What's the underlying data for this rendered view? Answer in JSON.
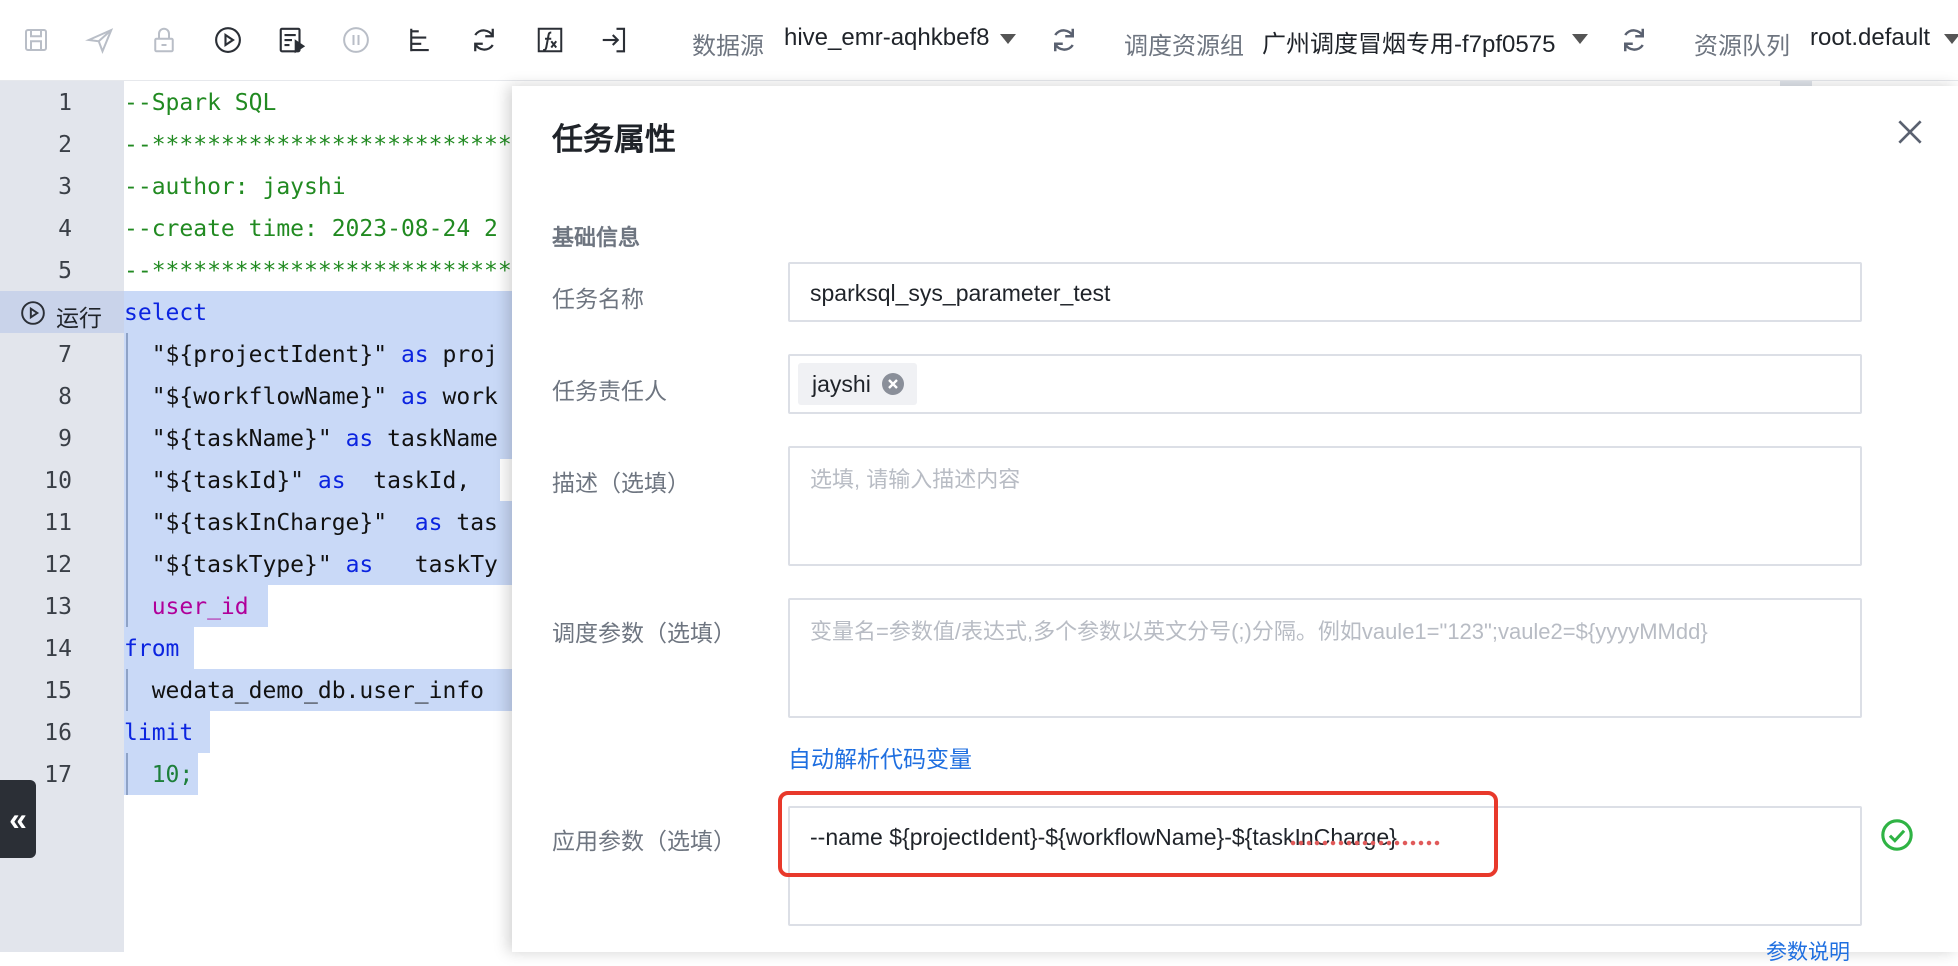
{
  "toolbar": {
    "icons": [
      "save-icon",
      "publish-icon",
      "lock-icon",
      "run-icon",
      "run-selected-icon",
      "stop-icon",
      "format-icon",
      "refresh-icon",
      "formula-icon",
      "exit-icon"
    ],
    "datasource_label": "数据源",
    "datasource_value": "hive_emr-aqhkbef8",
    "resource_group_label": "调度资源组",
    "resource_group_value": "广州调度冒烟专用-f7pf0575",
    "queue_label": "资源队列",
    "queue_value": "root.default"
  },
  "editor": {
    "run_label": "运行",
    "lines": [
      {
        "n": "1",
        "t": "--Spark SQL"
      },
      {
        "n": "2",
        "t": "--*******************************"
      },
      {
        "n": "3",
        "t": "--author: jayshi"
      },
      {
        "n": "4",
        "t": "--create time: 2023-08-24 2"
      },
      {
        "n": "5",
        "t": "--*******************************"
      },
      {
        "n": "6",
        "t": "select"
      },
      {
        "n": "7",
        "a": "  \"${projectIdent}\"",
        "b": " as ",
        "c": "proj"
      },
      {
        "n": "8",
        "a": "  \"${workflowName}\"",
        "b": " as ",
        "c": "work"
      },
      {
        "n": "9",
        "a": "  \"${taskName}\"",
        "b": " as ",
        "c": "taskName"
      },
      {
        "n": "10",
        "a": "  \"${taskId}\"",
        "b": " as ",
        "c": " taskId,"
      },
      {
        "n": "11",
        "a": "  \"${taskInCharge}\"",
        "b": "  as ",
        "c": "tas"
      },
      {
        "n": "12",
        "a": "  \"${taskType}\"",
        "b": " as ",
        "c": "  taskTy"
      },
      {
        "n": "13",
        "t": "  user_id"
      },
      {
        "n": "14",
        "t": "from"
      },
      {
        "n": "15",
        "t": "  wedata_demo_db.user_info"
      },
      {
        "n": "16",
        "t": "limit"
      },
      {
        "n": "17",
        "t": "  10;"
      }
    ],
    "collapse_label": "«"
  },
  "drawer": {
    "title": "任务属性",
    "section": "基础信息",
    "task_name_label": "任务名称",
    "task_name_value": "sparksql_sys_parameter_test",
    "owner_label": "任务责任人",
    "owner_tag": "jayshi",
    "desc_label": "描述（选填）",
    "desc_placeholder": "选填, 请输入描述内容",
    "sched_label": "调度参数（选填）",
    "sched_placeholder": "变量名=参数值/表达式,多个参数以英文分号(;)分隔。例如vaule1=\"123\";vaule2=${yyyyMMdd}",
    "auto_parse_link": "自动解析代码变量",
    "app_label": "应用参数（选填）",
    "app_value": "--name  ${projectIdent}-${workflowName}-${taskInCharge}",
    "param_help_link": "参数说明"
  },
  "colors": {
    "accent": "#1f6fe0",
    "highlight": "#e8392b",
    "success": "#2fb344",
    "selection": "#c9d9f7"
  }
}
